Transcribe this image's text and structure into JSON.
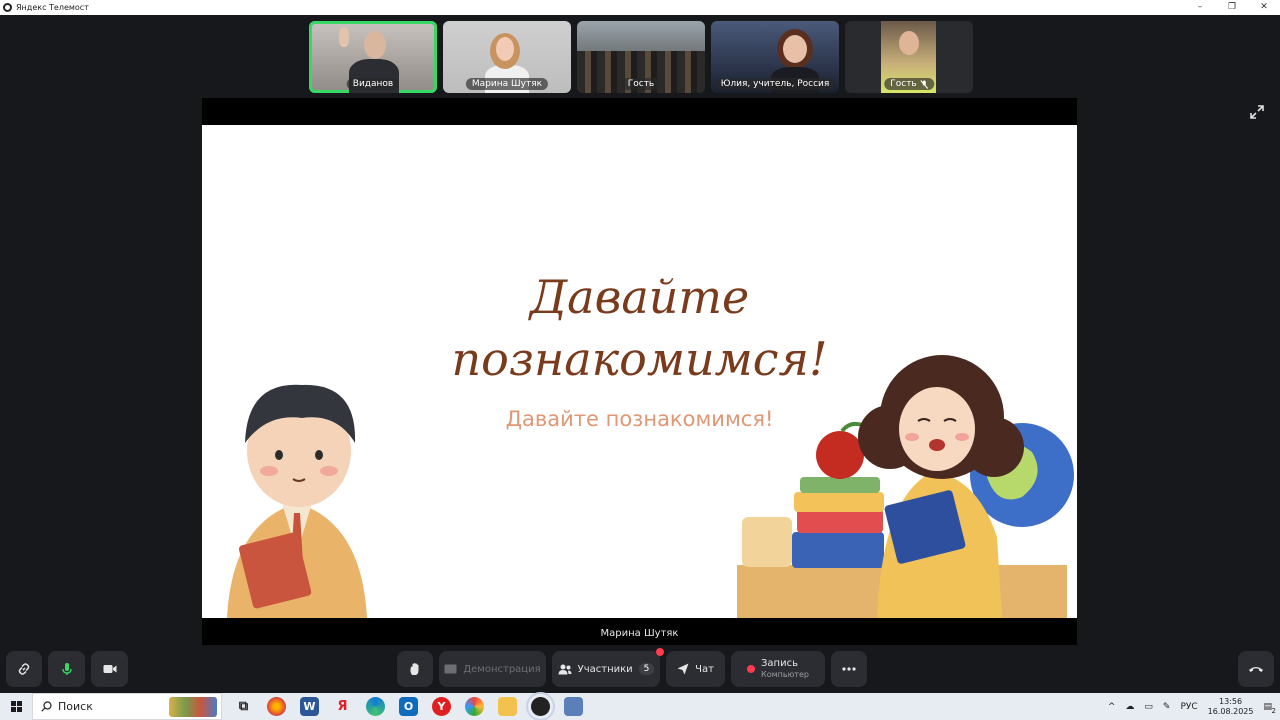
{
  "window": {
    "title": "Яндекс Телемост",
    "controls": [
      "–",
      "❐",
      "✕"
    ]
  },
  "participants": [
    {
      "name": "Виданов",
      "active": true,
      "muted": false
    },
    {
      "name": "Марина Шутяк",
      "active": false,
      "muted": false
    },
    {
      "name": "Гость",
      "active": false,
      "muted": false
    },
    {
      "name": "Юлия, учитель, Россия",
      "active": false,
      "muted": false
    },
    {
      "name": "Гость",
      "active": false,
      "muted": true
    }
  ],
  "slide": {
    "title_line1": "Давайте",
    "title_line2": "познакомимся!",
    "subtitle": "Давайте познакомимся!"
  },
  "presenter_label": "Марина Шутяк",
  "toolbar": {
    "demo_label": "Демонстрация",
    "participants_label": "Участники",
    "participants_count": "5",
    "chat_label": "Чат",
    "record_label": "Запись",
    "record_sub": "Компьютер"
  },
  "taskbar": {
    "search_label": "Поиск",
    "lang": "РУС",
    "time": "13:56",
    "date": "16.08.2025",
    "notifications": "2"
  },
  "colors": {
    "active_speaker": "#37d866",
    "record_dot": "#ff3b4e",
    "title_brown": "#7a3a1c",
    "subtitle_salmon": "#e09774"
  }
}
